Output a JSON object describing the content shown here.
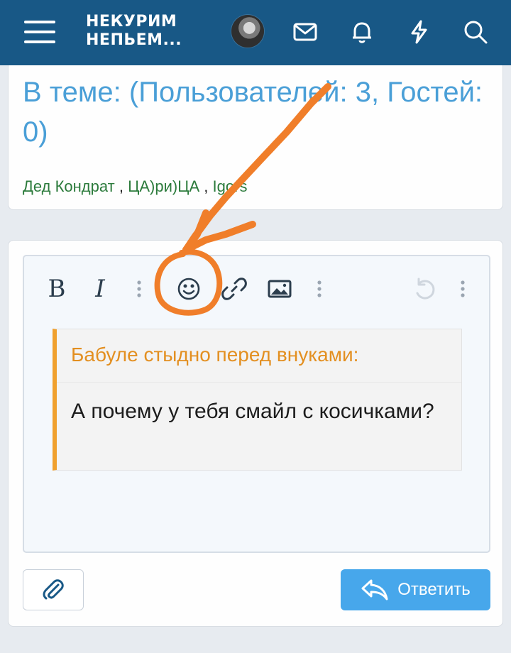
{
  "header": {
    "logo_line1": "НЕКУРИМ",
    "logo_line2": "НЕПЬЕМ...",
    "icons": [
      "menu-icon",
      "avatar",
      "envelope-icon",
      "bell-icon",
      "bolt-icon",
      "search-icon"
    ],
    "background_color": "#185886"
  },
  "online": {
    "title": "В теме: (Пользователей: 3, Гостей: 0)",
    "users": [
      "Дед Кондрат",
      "ЦА)ри)ЦА",
      "Igors"
    ],
    "separator": ","
  },
  "editor": {
    "toolbar": {
      "bold_label": "B",
      "italic_label": "I",
      "icons": [
        "more-vertical-icon",
        "smiley-icon",
        "link-icon",
        "image-icon",
        "more-vertical-icon",
        "undo-icon",
        "more-vertical-icon"
      ]
    },
    "quote": {
      "author": "Бабуле стыдно перед внуками:",
      "text": "А почему у тебя смайл с косичками?",
      "accent_color": "#f0a02d"
    }
  },
  "actions": {
    "attach_icon": "paperclip-icon",
    "reply_label": "Ответить",
    "reply_icon": "reply-icon",
    "reply_color": "#47a7eb"
  },
  "annotation": {
    "type": "hand-drawn orange arrow and circle around smiley button",
    "color": "#f07e2a"
  }
}
